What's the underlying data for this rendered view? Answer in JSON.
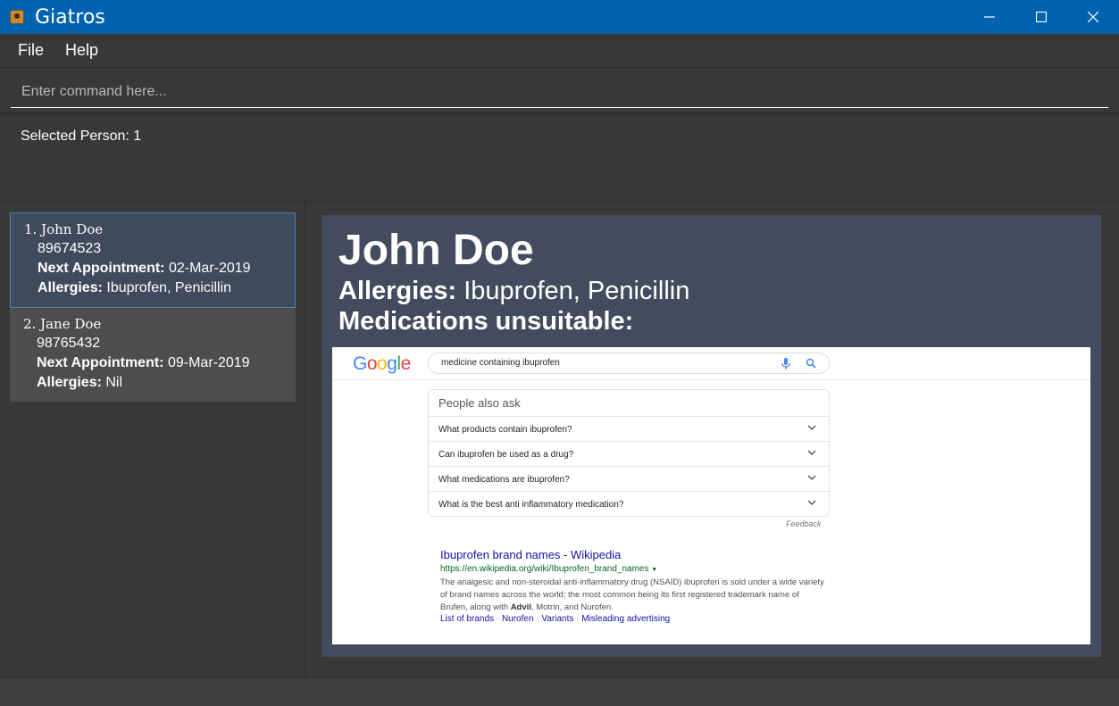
{
  "window": {
    "title": "Giatros",
    "controls": [
      "minimize-icon",
      "maximize-icon",
      "close-icon"
    ]
  },
  "menu": {
    "file": "File",
    "help": "Help"
  },
  "command": {
    "placeholder": "Enter command here..."
  },
  "result": {
    "text": "Selected Person: 1"
  },
  "persons": [
    {
      "index_name": "1. John Doe",
      "phone": "89674523",
      "appointment_label": "Next Appointment:",
      "appointment": "02-Mar-2019",
      "allergies_label": "Allergies:",
      "allergies": "Ibuprofen, Penicillin"
    },
    {
      "index_name": "2. Jane Doe",
      "phone": "98765432",
      "appointment_label": "Next Appointment:",
      "appointment": "09-Mar-2019",
      "allergies_label": "Allergies:",
      "allergies": "Nil"
    }
  ],
  "detail": {
    "name": "John Doe",
    "allergies_label": "Allergies:",
    "allergies": "Ibuprofen, Penicillin",
    "medications_label": "Medications unsuitable:"
  },
  "search_screenshot": {
    "logo": "Google",
    "query": "medicine containing ibuprofen",
    "paa_title": "People also ask",
    "questions": [
      "What products contain ibuprofen?",
      "Can ibuprofen be used as a drug?",
      "What medications are ibuprofen?",
      "What is the best anti inflammatory medication?"
    ],
    "feedback": "Feedback",
    "result_title": "Ibuprofen brand names - Wikipedia",
    "result_url": "https://en.wikipedia.org/wiki/Ibuprofen_brand_names",
    "result_desc_1": "The analgesic and non-steroidal anti-inflammatory drug (NSAID) ibuprofen is sold under a wide variety of brand names across the world; the most common being its first registered trademark name of Brufen, along with ",
    "result_desc_bold": "Advil",
    "result_desc_2": ", Motrin, and Nurofen.",
    "links": [
      "List of brands",
      "Nurofen",
      "Variants",
      "Misleading advertising"
    ]
  },
  "colors": {
    "titlebar": "#0063b1",
    "selected_card": "#3f4a5c",
    "card": "#4d4d4d",
    "detail_panel": "#434c5e",
    "background": "#383838"
  }
}
